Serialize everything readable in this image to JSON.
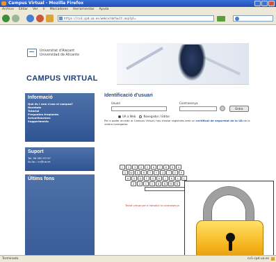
{
  "window": {
    "title": "Campus Virtual - Mozilla Firefox"
  },
  "menu": [
    "Archivo",
    "Editar",
    "Ver",
    "Ir",
    "Marcadores",
    "Herramientas",
    "Ayuda"
  ],
  "toolbar": {
    "url": "https://cv1.cpd.ua.es/webcv/default.asp?pl="
  },
  "site": {
    "university_line1": "Universitat d'Alacant",
    "university_line2": "Universidad de Alicante",
    "title": "CAMPUS VIRTUAL"
  },
  "informacio": {
    "heading": "Informació",
    "links": [
      "Què és i com s'usa el campus?",
      "Novetats",
      "Tutorial",
      "Preguntes freqüents",
      "Actualitzacions",
      "Suggeriments"
    ]
  },
  "suport": {
    "heading": "Suport",
    "lines": [
      "Tel. 96 590 93 97",
      "Av.Ap.: cv@ua.es"
    ]
  },
  "ultims": {
    "heading": "Últims fons"
  },
  "login": {
    "heading": "Identificació d'usuari",
    "user_label": "Usuari",
    "pass_label": "Contrasenya",
    "enter_label": "Entra",
    "option1": "UA a Web",
    "option2": "Navegador / Editor",
    "note_prefix": "Per a poder accedir al Campus Virtual, heu d'estar registrats amb un",
    "note_link": "certificat de seguretat de la UA",
    "note_suffix": "de la vostra navegador."
  },
  "keyboard": {
    "row1": [
      "1",
      "2",
      "3",
      "4",
      "5",
      "6",
      "7",
      "8",
      "9",
      "0"
    ],
    "row2": [
      "Q",
      "W",
      "E",
      "R",
      "T",
      "Y",
      "U",
      "I",
      "O",
      "P"
    ],
    "row3": [
      "A",
      "S",
      "D",
      "F",
      "G",
      "H",
      "J",
      "K",
      "L",
      "Ç"
    ],
    "row4": [
      "Z",
      "X",
      "C",
      "V",
      "B",
      "N",
      "M",
      "Ñ"
    ],
    "note": "Teclat virtual per a introduir la contrasenya"
  },
  "status": {
    "left": "Terminado",
    "right": "cv1.cpd.ua.es"
  },
  "colors": {
    "brand_blue": "#2f5493",
    "lock_gold": "#f5b21a"
  }
}
